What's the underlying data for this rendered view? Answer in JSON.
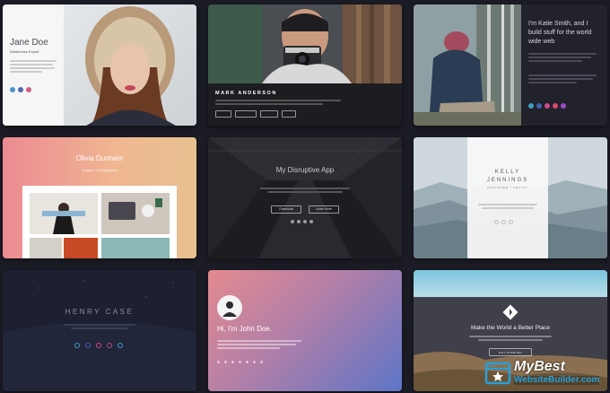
{
  "templates": [
    {
      "name": "Jane Doe",
      "subtitle": "Wilderness Expert"
    },
    {
      "name": "MARK ANDERSON",
      "buttons": [
        "",
        "",
        "",
        ""
      ]
    },
    {
      "heading_line1": "I'm Katie Smith, and I",
      "heading_line2": "build stuff for the world",
      "heading_line3": "wide web"
    },
    {
      "name": "Olivia Dunham",
      "subtitle": "Designer & Photographer"
    },
    {
      "title": "My Disruptive App",
      "buttons": [
        "Download",
        "Learn More"
      ]
    },
    {
      "name_line1": "KELLY",
      "name_line2": "JENNINGS",
      "subtitle": "DESIGNER / ARTIST"
    },
    {
      "name": "HENRY CASE"
    },
    {
      "title": "Hi, I'm John Doe."
    },
    {
      "title": "Make the World a Better Place",
      "button": "GET STARTED"
    }
  ],
  "watermark": {
    "line1": "MyBest",
    "line2": "WebsiteBuilder.com"
  },
  "colors": {
    "page_bg": "#1c1c26",
    "watermark_blue": "#2a9fd6",
    "watermark_white": "#ffffff"
  }
}
